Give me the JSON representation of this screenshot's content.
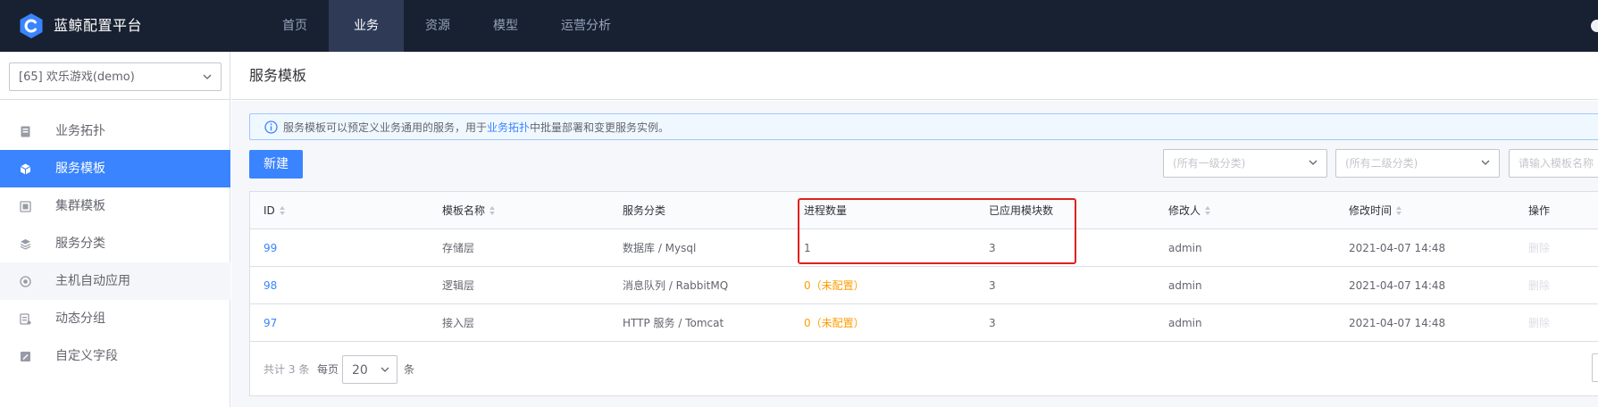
{
  "app": {
    "title": "蓝鲸配置平台"
  },
  "top_nav": {
    "items": [
      {
        "label": "首页"
      },
      {
        "label": "业务"
      },
      {
        "label": "资源"
      },
      {
        "label": "模型"
      },
      {
        "label": "运营分析"
      }
    ],
    "active_index": 1
  },
  "sidebar": {
    "business_select": {
      "value": "[65] 欢乐游戏(demo)"
    },
    "items": [
      {
        "label": "业务拓扑",
        "icon": "topology-icon"
      },
      {
        "label": "服务模板",
        "icon": "cube-icon"
      },
      {
        "label": "集群模板",
        "icon": "cluster-icon"
      },
      {
        "label": "服务分类",
        "icon": "layers-icon"
      },
      {
        "label": "主机自动应用",
        "icon": "auto-apply-icon"
      },
      {
        "label": "动态分组",
        "icon": "dynamic-group-icon"
      },
      {
        "label": "自定义字段",
        "icon": "custom-field-icon"
      }
    ],
    "active_index": 1,
    "hover_index": 4
  },
  "page": {
    "title": "服务模板",
    "alert": {
      "text_before": "服务模板可以预定义业务通用的服务，用于",
      "link": "业务拓扑",
      "text_after": "中批量部署和变更服务实例。"
    },
    "new_button": "新建",
    "filters": {
      "first_category": "(所有一级分类)",
      "second_category": "(所有二级分类)",
      "search_placeholder": "请输入模板名称"
    }
  },
  "table": {
    "columns": [
      "ID",
      "模板名称",
      "服务分类",
      "进程数量",
      "已应用模块数",
      "修改人",
      "修改时间",
      "操作"
    ],
    "rows": [
      {
        "id": "99",
        "name": "存储层",
        "category": "数据库 / Mysql",
        "process_count": "1",
        "module_count": "3",
        "modifier": "admin",
        "modified_time": "2021-04-07 14:48",
        "action": "删除"
      },
      {
        "id": "98",
        "name": "逻辑层",
        "category": "消息队列 / RabbitMQ",
        "process_count": "0（未配置）",
        "module_count": "3",
        "modifier": "admin",
        "modified_time": "2021-04-07 14:48",
        "action": "删除"
      },
      {
        "id": "97",
        "name": "接入层",
        "category": "HTTP 服务 / Tomcat",
        "process_count": "0（未配置）",
        "module_count": "3",
        "modifier": "admin",
        "modified_time": "2021-04-07 14:48",
        "action": "删除"
      }
    ]
  },
  "pagination": {
    "total_prefix": "共计",
    "total": "3",
    "total_suffix": "条",
    "per_page_label": "每页",
    "per_page": "20",
    "unit": "条"
  },
  "colors": {
    "primary": "#3a84ff",
    "header_bg": "#182132",
    "warning": "#ff9c01",
    "highlight_border": "#e0201b"
  }
}
